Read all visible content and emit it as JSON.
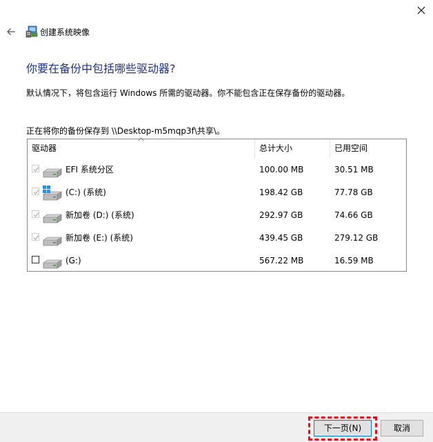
{
  "window": {
    "title": "创建系统映像"
  },
  "page": {
    "heading": "你要在备份中包括哪些驱动器?",
    "description": "默认情况下，将包含运行 Windows 所需的驱动器。你不能包含正在保存备份的驱动器。",
    "save_path": "正在将你的备份保存到 \\\\Desktop-m5mqp3f\\共享\\。"
  },
  "table": {
    "columns": [
      "驱动器",
      "总计大小",
      "已用空间"
    ],
    "rows": [
      {
        "name": "EFI 系统分区",
        "total": "100.00 MB",
        "used": "30.51 MB",
        "checked": true,
        "enabled": false,
        "icon": "drive-icon"
      },
      {
        "name": "(C:) (系统)",
        "total": "198.42 GB",
        "used": "77.78 GB",
        "checked": true,
        "enabled": false,
        "icon": "windows-drive-icon"
      },
      {
        "name": "新加卷 (D:) (系统)",
        "total": "292.97 GB",
        "used": "74.66 GB",
        "checked": true,
        "enabled": false,
        "icon": "drive-icon"
      },
      {
        "name": "新加卷 (E:) (系统)",
        "total": "439.45 GB",
        "used": "279.12 GB",
        "checked": true,
        "enabled": false,
        "icon": "drive-icon"
      },
      {
        "name": "(G:)",
        "total": "567.22 MB",
        "used": "16.59 MB",
        "checked": false,
        "enabled": true,
        "icon": "drive-icon"
      }
    ]
  },
  "footer": {
    "next_label": "下一页(N)",
    "cancel_label": "取消"
  },
  "colors": {
    "heading": "#1e3287",
    "highlight": "#e1101a",
    "focus_border": "#0078d7"
  }
}
